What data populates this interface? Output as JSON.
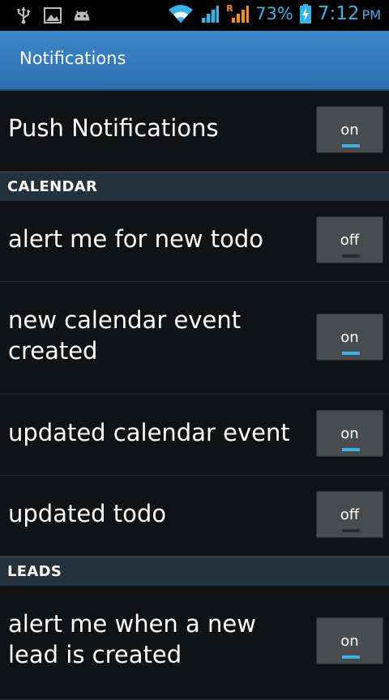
{
  "status_bar": {
    "left_icons": [
      "usb-icon",
      "image-icon",
      "android-icon"
    ],
    "battery_percent": "73%",
    "time": "7:12",
    "ampm": "PM",
    "roaming_indicator": "R",
    "accent_color": "#33b5e5"
  },
  "action_bar": {
    "title": "Notifications",
    "color": "#3d86c7"
  },
  "push": {
    "label": "Push Notifications",
    "state": "on"
  },
  "sections": {
    "calendar": "CALENDAR",
    "leads": "LEADS"
  },
  "calendar_items": [
    {
      "label": "alert me for new todo",
      "state": "off"
    },
    {
      "label": "new calendar event created",
      "state": "on"
    },
    {
      "label": "updated calendar event",
      "state": "on"
    },
    {
      "label": "updated todo",
      "state": "off"
    }
  ],
  "lead_items": [
    {
      "label": "alert me when a new lead is created",
      "state": "on"
    }
  ]
}
